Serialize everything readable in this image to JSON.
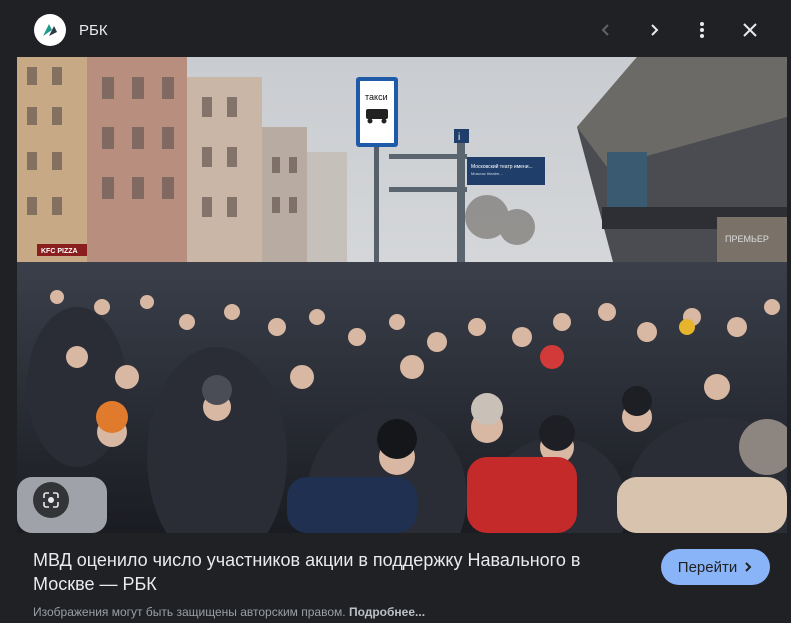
{
  "header": {
    "source_name": "РБК",
    "logo_icon": "rbc-logo-icon",
    "prev_icon": "chevron-left-icon",
    "next_icon": "chevron-right-icon",
    "more_icon": "more-vert-icon",
    "close_icon": "close-icon"
  },
  "image": {
    "sign_taxi": "такси",
    "sign_direction_1": "Московский театр имени...",
    "sign_direction_2": "Moscow theatre...",
    "sign_info": "i",
    "shop_sign": "KFC PIZZA",
    "building_sign": "ПРЕМЬЕР",
    "lens_icon": "google-lens-icon"
  },
  "footer": {
    "title": "МВД оценило число участников акции в поддержку Навального в Москве — РБК",
    "visit_button": "Перейти",
    "visit_icon": "chevron-right-icon",
    "notice_text": "Изображения могут быть защищены авторским правом.",
    "more_link": "Подробнее..."
  },
  "colors": {
    "background": "#202124",
    "accent": "#8ab4f8",
    "text": "#e8eaed",
    "muted": "#9aa0a6"
  }
}
